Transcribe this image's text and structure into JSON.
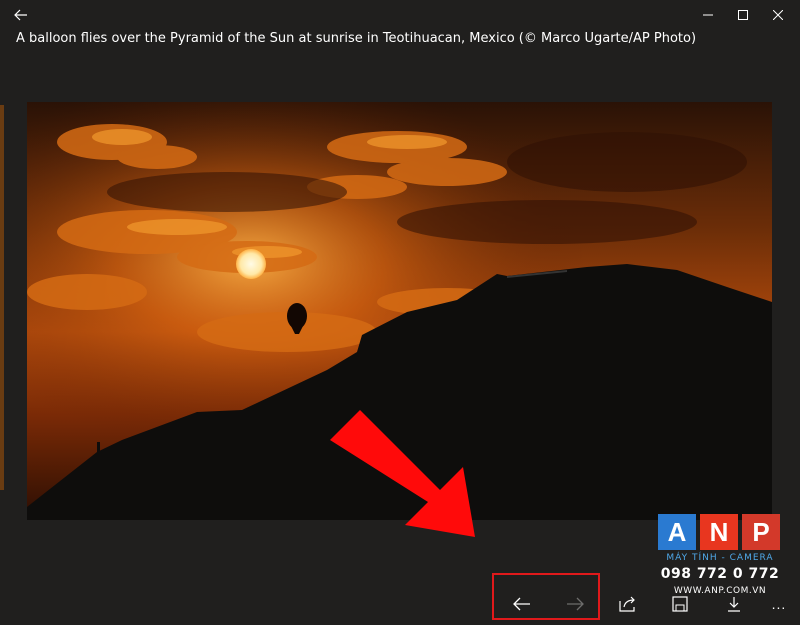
{
  "window": {
    "caption": "A balloon flies over the Pyramid of the Sun at sunrise in Teotihuacan, Mexico (© Marco Ugarte/AP Photo)"
  },
  "titlebar": {
    "back_icon": "arrow-left-icon",
    "controls": [
      "minimize-icon",
      "maximize-icon",
      "close-icon"
    ]
  },
  "toolbar": {
    "items": [
      {
        "name": "previous-button",
        "icon": "arrow-left-icon",
        "enabled": true
      },
      {
        "name": "next-button",
        "icon": "arrow-right-icon",
        "enabled": false
      },
      {
        "name": "share-button",
        "icon": "share-icon"
      },
      {
        "name": "save-button",
        "icon": "save-icon"
      },
      {
        "name": "download-button",
        "icon": "download-icon"
      },
      {
        "name": "more-button",
        "icon": "more-icon",
        "label": "..."
      }
    ]
  },
  "watermark": {
    "letters": [
      "A",
      "N",
      "P"
    ],
    "tagline": "MÁY TÍNH - CAMERA",
    "phone": "098 772 0 772",
    "website": "WWW.ANP.COM.VN",
    "colors": [
      "#2a7ad1",
      "#e8361f",
      "#d3392a"
    ]
  },
  "annotation": {
    "arrow_color": "#ff0a0a",
    "box_color": "#e0191b"
  }
}
